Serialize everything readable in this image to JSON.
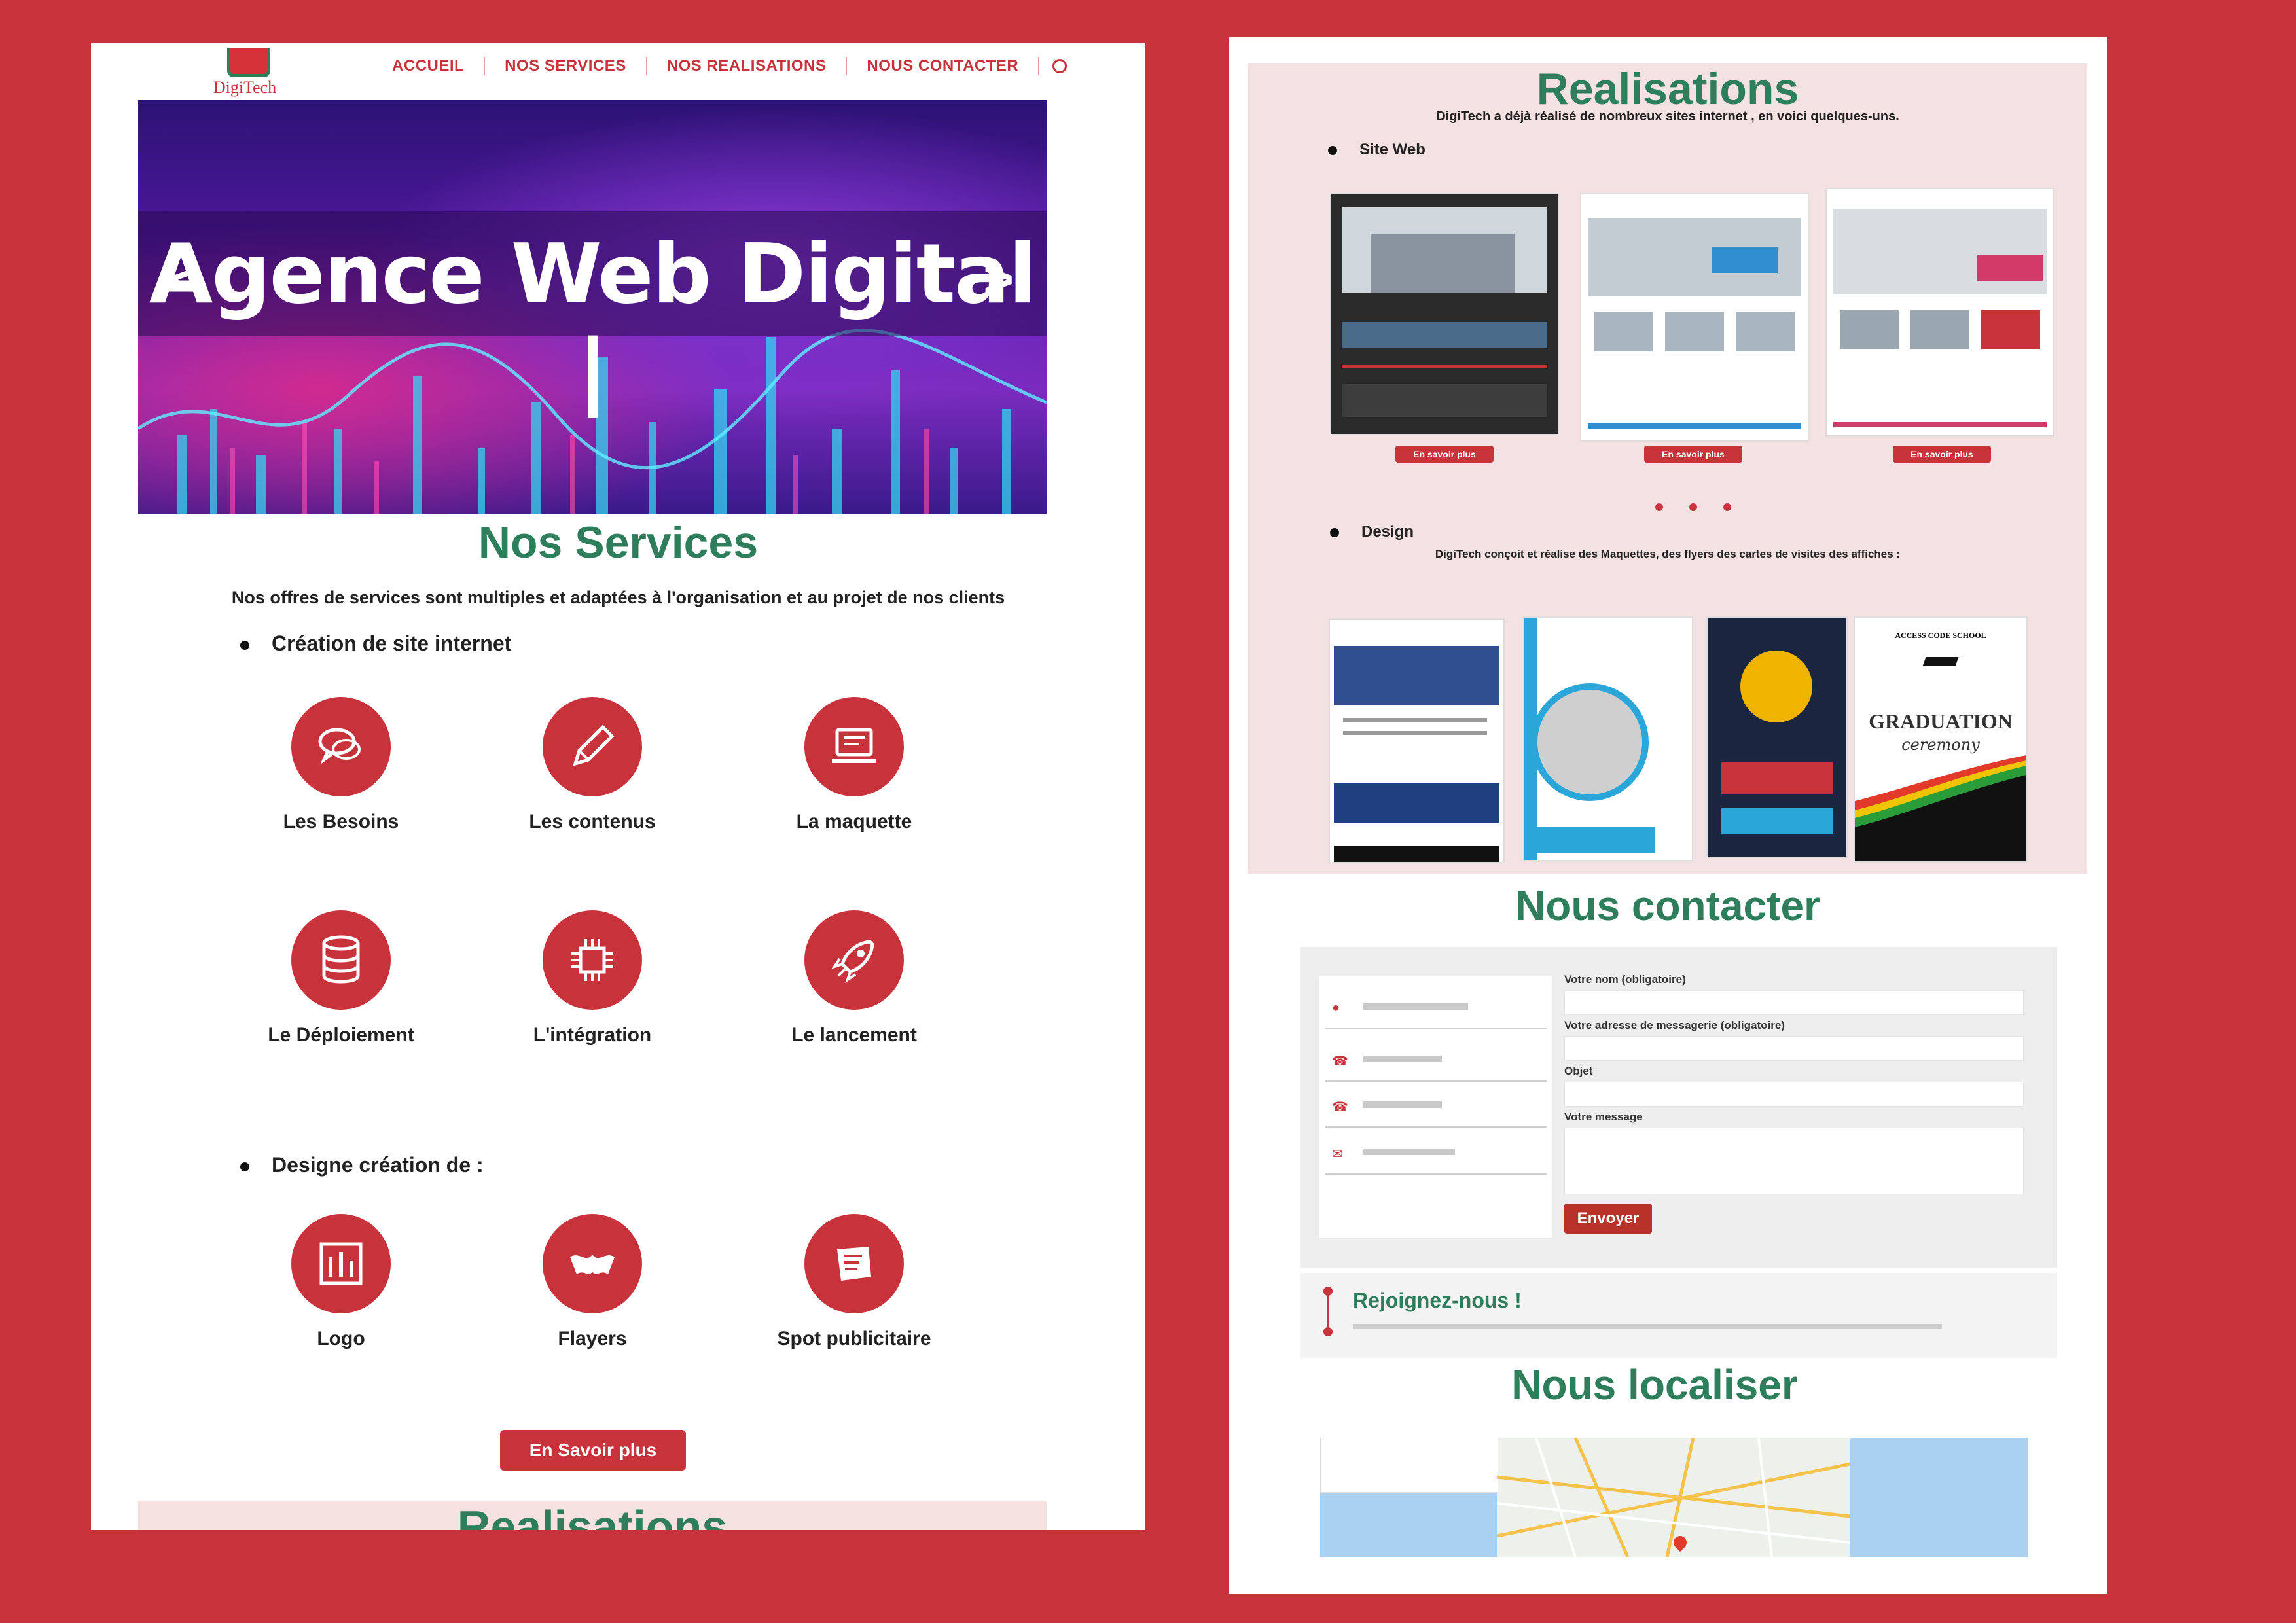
{
  "brand": {
    "logo_text": "DigiTech"
  },
  "nav": {
    "items": [
      "ACCUEIL",
      "NOS SERVICES",
      "NOS REALISATIONS",
      "NOUS CONTACTER"
    ]
  },
  "hero": {
    "title": "Agence Web Digital |",
    "prev": "<",
    "next": ">"
  },
  "services": {
    "title": "Nos Services",
    "subtitle": "Nos offres de services sont multiples et adaptées à l'organisation et au projet de nos clients",
    "group1_title": "Création de site internet",
    "group1": [
      {
        "icon": "chat-icon",
        "title": "Les Besoins"
      },
      {
        "icon": "pencil-icon",
        "title": "Les contenus"
      },
      {
        "icon": "laptop-icon",
        "title": "La maquette"
      },
      {
        "icon": "database-icon",
        "title": "Le Déploiement"
      },
      {
        "icon": "chip-icon",
        "title": "L'intégration"
      },
      {
        "icon": "rocket-icon",
        "title": "Le lancement"
      }
    ],
    "group2_title": "Designe création de :",
    "group2": [
      {
        "icon": "logo-design-icon",
        "title": "Logo"
      },
      {
        "icon": "flyer-icon",
        "title": "Flayers"
      },
      {
        "icon": "ad-spot-icon",
        "title": "Spot publicitaire"
      }
    ],
    "cta": "En Savoir plus"
  },
  "realisations": {
    "title": "Realisations",
    "intro": "DigiTech a déjà réalisé de nombreux sites internet , en voici quelques-uns.",
    "web_title": "Site Web",
    "web_button": "En savoir plus",
    "design_title": "Design",
    "design_intro": "DigiTech conçoit et réalise des Maquettes, des flyers des cartes de visites des affiches :",
    "graduation_small": "ACCESS CODE SCHOOL",
    "graduation_big": "GRADUATION",
    "graduation_script": "ceremony"
  },
  "contact": {
    "title": "Nous contacter",
    "labels": [
      "Votre nom (obligatoire)",
      "Votre adresse de messagerie (obligatoire)",
      "Objet",
      "Votre message"
    ],
    "submit": "Envoyer",
    "join_title": "Rejoignez-nous !"
  },
  "locate": {
    "title": "Nous localiser"
  },
  "colors": {
    "accent": "#c8323a",
    "green": "#2e7d5b",
    "pink": "#f4e1e1"
  }
}
